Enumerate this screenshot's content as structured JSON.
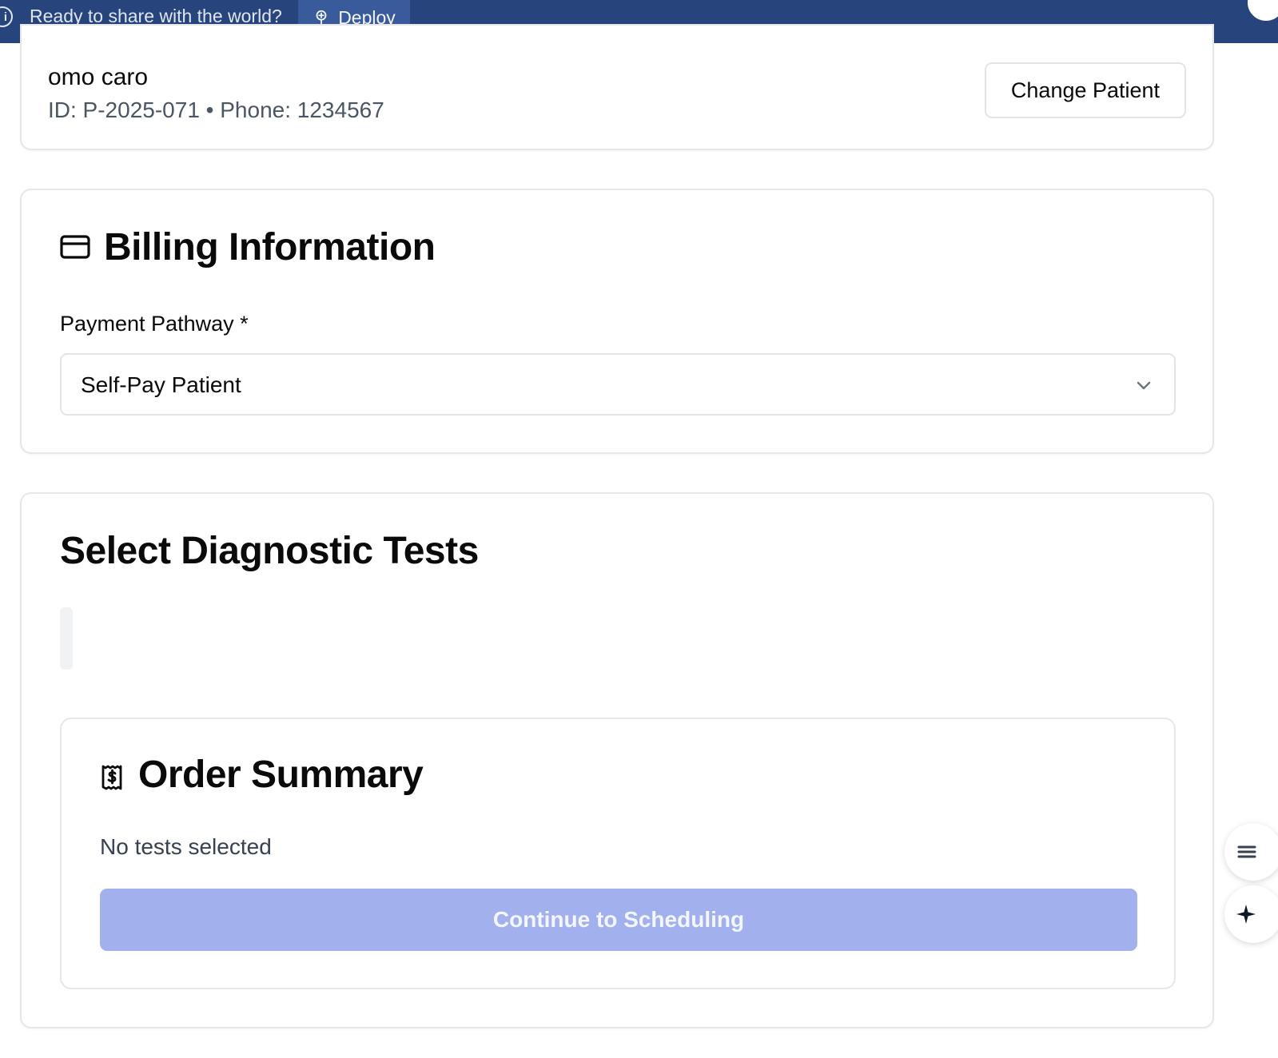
{
  "banner": {
    "message": "Ready to share with the world?",
    "deploy_label": "Deploy",
    "background": "#27447c"
  },
  "patient": {
    "name": "omo caro",
    "meta": "ID: P-2025-071 • Phone: 1234567",
    "change_label": "Change Patient"
  },
  "billing": {
    "title": "Billing Information",
    "icon": "credit-card-icon",
    "field_label": "Payment Pathway *",
    "selected_value": "Self-Pay Patient"
  },
  "tests": {
    "title": "Select Diagnostic Tests"
  },
  "summary": {
    "title": "Order Summary",
    "icon": "receipt-dollar-icon",
    "empty_text": "No tests selected",
    "continue_label": "Continue to Scheduling",
    "continue_color": "#a2b1ee"
  },
  "floating": {
    "icons": [
      "list-icon",
      "sparkle-icon"
    ]
  }
}
